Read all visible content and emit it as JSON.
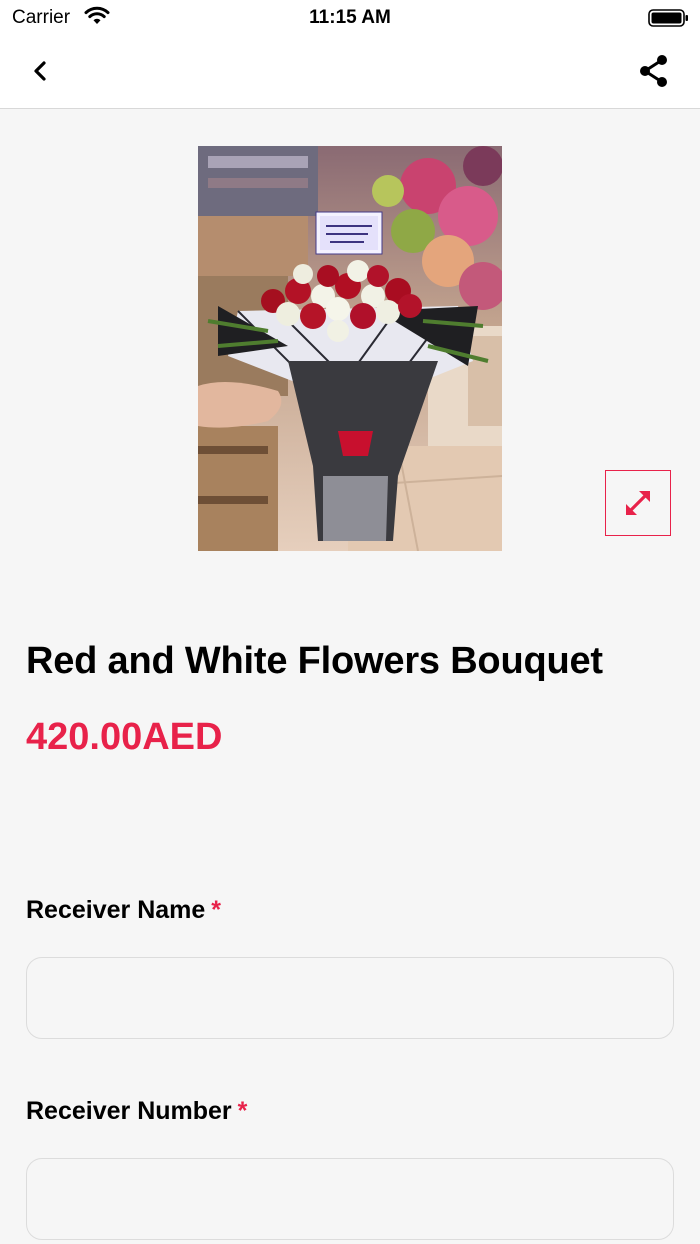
{
  "status_bar": {
    "carrier": "Carrier",
    "time": "11:15 AM"
  },
  "nav": {
    "back_icon": "chevron-left-icon",
    "share_icon": "share-icon"
  },
  "product": {
    "title": "Red and White Flowers Bouquet",
    "price": "420.00AED",
    "expand_icon": "expand-arrows-icon"
  },
  "form": {
    "receiver_name": {
      "label": "Receiver Name",
      "required_mark": "*",
      "value": "",
      "placeholder": ""
    },
    "receiver_number": {
      "label": "Receiver Number",
      "required_mark": "*",
      "value": "",
      "placeholder": ""
    }
  },
  "colors": {
    "accent": "#e8224a",
    "background": "#f6f6f6"
  }
}
